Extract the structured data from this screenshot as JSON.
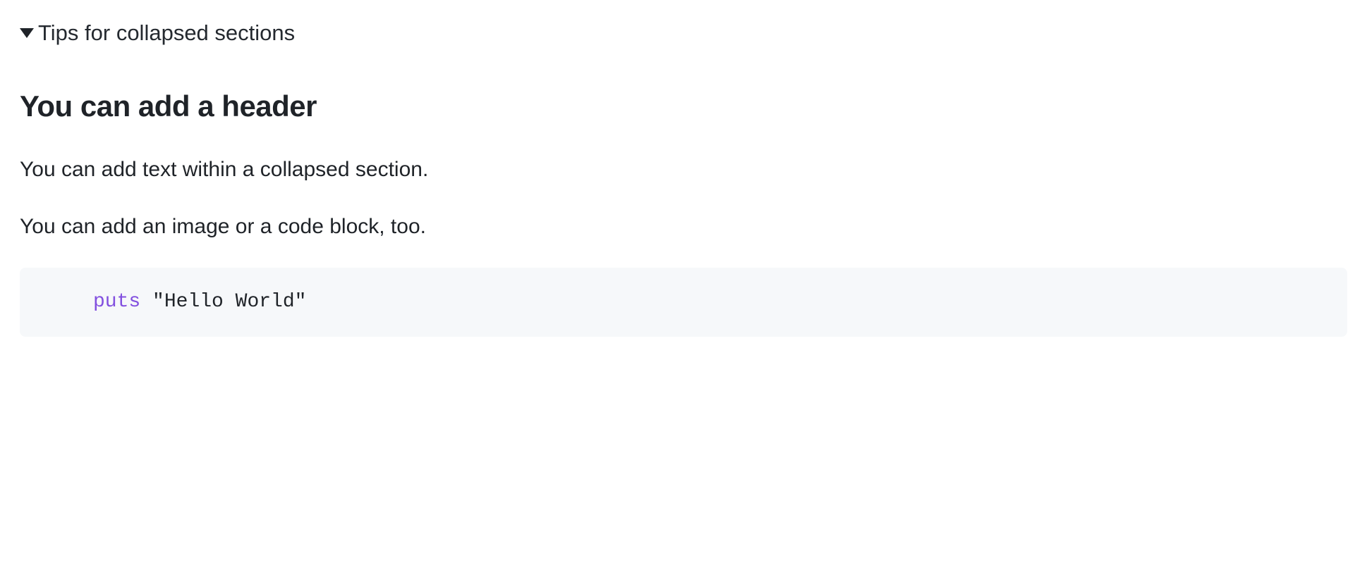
{
  "summary": {
    "label": "Tips for collapsed sections"
  },
  "content": {
    "header": "You can add a header",
    "paragraph1": "You can add text within a collapsed section.",
    "paragraph2": "You can add an image or a code block, too."
  },
  "code": {
    "keyword": "puts",
    "string": "\"Hello World\""
  }
}
